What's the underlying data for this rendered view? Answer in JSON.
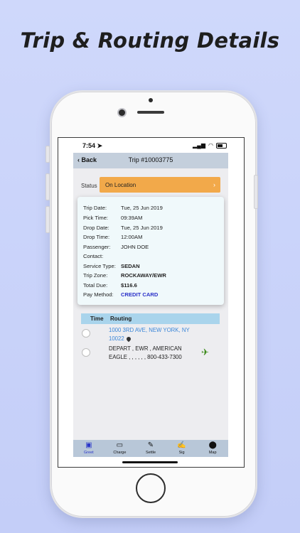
{
  "headline": "Trip & Routing Details",
  "status_bar": {
    "time": "7:54",
    "signal": "▂▄▆",
    "wifi": "◠"
  },
  "nav": {
    "back_label": "Back",
    "title": "Trip #10003775"
  },
  "status": {
    "label": "Status",
    "value": "On Location",
    "color": "#f2a94a"
  },
  "trip": [
    {
      "label": "Trip Date:",
      "value": "Tue, 25 Jun 2019"
    },
    {
      "label": "Pick Time:",
      "value": "09:39AM"
    },
    {
      "label": "Drop Date:",
      "value": "Tue, 25 Jun 2019"
    },
    {
      "label": "Drop Time:",
      "value": "12:00AM"
    },
    {
      "label": "Passenger:",
      "value": "JOHN DOE"
    },
    {
      "label": "Contact:",
      "value": ""
    },
    {
      "label": "Service Type:",
      "value": "SEDAN"
    },
    {
      "label": "Trip Zone:",
      "value": "ROCKAWAY/EWR"
    },
    {
      "label": "Total Due:",
      "value": "$116.6"
    },
    {
      "label": "Pay Method:",
      "value": "CREDIT CARD"
    }
  ],
  "routing": {
    "col_time": "Time",
    "col_routing": "Routing",
    "stops": [
      {
        "text": "1000 3RD AVE, NEW YORK, NY 10022"
      },
      {
        "text": "DEPART , EWR , AMERICAN EAGLE , , , , , , 800-433-7300"
      }
    ]
  },
  "tabs": [
    {
      "label": "Greet",
      "icon": "id-card-icon",
      "active": true
    },
    {
      "label": "Charge",
      "icon": "credit-card-icon",
      "active": false
    },
    {
      "label": "Settle",
      "icon": "pencil-icon",
      "active": false
    },
    {
      "label": "Sig",
      "icon": "edit-icon",
      "active": false
    },
    {
      "label": "Map",
      "icon": "map-pin-icon",
      "active": false
    }
  ],
  "colors": {
    "pay_method": "#2930c8",
    "address_link": "#3a86d8",
    "plane": "#3b8a1a",
    "tab_active": "#2a36c9"
  }
}
